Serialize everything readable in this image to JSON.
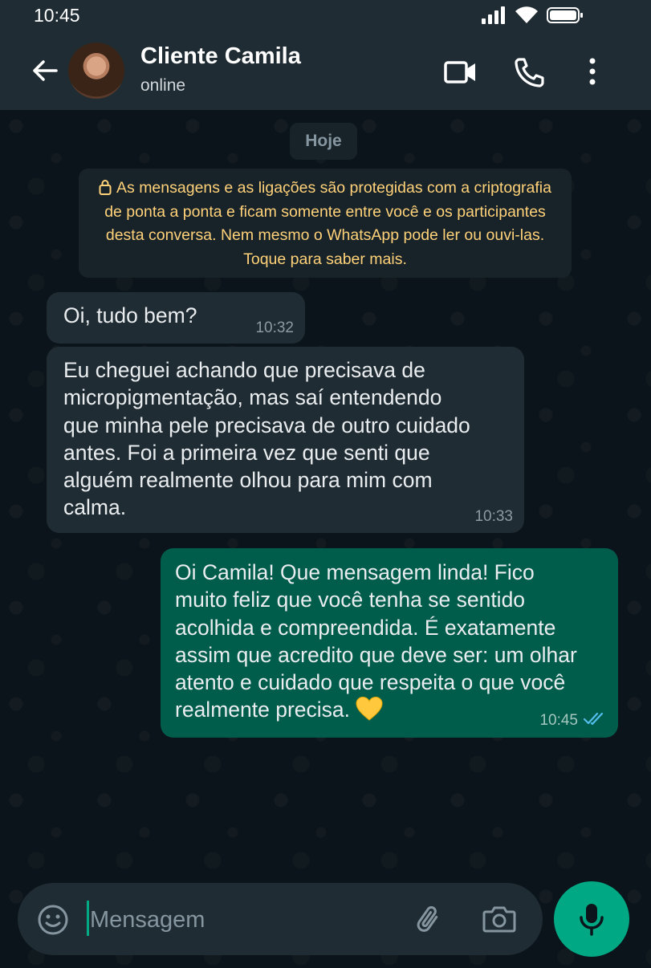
{
  "status_bar": {
    "time": "10:45"
  },
  "header": {
    "contact_name": "Cliente Camila",
    "contact_status": "online"
  },
  "chat": {
    "date_chip": "Hoje",
    "system_notice": "As mensagens e as ligações são protegidas com a criptografia de ponta a ponta e ficam somente entre você e os participantes desta conversa. Nem mesmo o WhatsApp pode ler ou ouvi-las. Toque para saber mais.",
    "messages": [
      {
        "direction": "in",
        "text": "Oi, tudo bem?",
        "time": "10:32"
      },
      {
        "direction": "in",
        "text": "Eu cheguei achando que precisava de\nmicropigmentação, mas saí entendendo\nque minha pele precisava de outro cuidado\nantes. Foi a primeira vez que senti que\nalguém realmente olhou para mim com\ncalma.",
        "time": "10:33"
      },
      {
        "direction": "out",
        "text": "Oi Camila! Que mensagem linda! Fico\nmuito feliz que você tenha se sentido\nacolhida e compreendida. É exatamente\nassim que acredito que deve ser: um olhar\natento e cuidado que respeita o que você\nrealmente precisa.",
        "time": "10:45",
        "read_status": "read",
        "emoji": "yellow-heart"
      }
    ]
  },
  "composer": {
    "placeholder": "Mensagem",
    "value": ""
  },
  "icons": {
    "back": "arrow-left-icon",
    "video_call": "video-camera-icon",
    "voice_call": "phone-icon",
    "menu": "kebab-menu-icon",
    "emoji": "smiley-icon",
    "attach": "paperclip-icon",
    "camera": "camera-icon",
    "mic": "microphone-icon",
    "lock": "lock-icon",
    "ticks": "double-check-icon"
  },
  "colors": {
    "header_bg": "#1f2c33",
    "chat_bg": "#0b141a",
    "incoming_bubble": "#202c33",
    "outgoing_bubble": "#005c4b",
    "notice_text": "#ffd279",
    "accent": "#00a884",
    "read_ticks": "#53bdeb"
  }
}
